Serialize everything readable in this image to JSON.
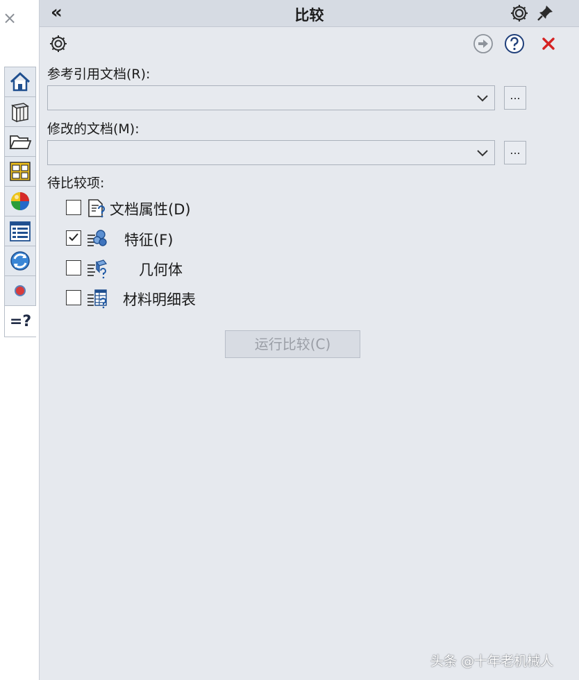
{
  "window": {
    "close_glyph": "×"
  },
  "task_tabs": [
    {
      "name": "home",
      "icon": "home-icon"
    },
    {
      "name": "design-library",
      "icon": "books-icon"
    },
    {
      "name": "file-explorer",
      "icon": "folder-icon"
    },
    {
      "name": "view-palette",
      "icon": "palette-icon"
    },
    {
      "name": "appearances",
      "icon": "appearance-ball-icon"
    },
    {
      "name": "custom-properties",
      "icon": "properties-list-icon"
    },
    {
      "name": "solidworks-resources",
      "icon": "refresh-globe-icon"
    },
    {
      "name": "solidworks-forum",
      "icon": "red-dot-icon"
    },
    {
      "name": "compare",
      "icon": "compare-icon",
      "glyph": "=?"
    }
  ],
  "title_bar": {
    "collapse_glyph": "«",
    "title": "比较"
  },
  "toolbar": {
    "options_icon": "gear-icon",
    "next_icon": "arrow-right-icon",
    "help_icon": "help-icon",
    "cancel_icon": "close-icon"
  },
  "reference_doc": {
    "label": "参考引用文档(R):",
    "value": "",
    "browse_label": "..."
  },
  "modified_doc": {
    "label": "修改的文档(M):",
    "value": "",
    "browse_label": "..."
  },
  "compare_items": {
    "label": "待比较项:",
    "items": [
      {
        "label": "文档属性(D)",
        "checked": false,
        "icon": "document-properties-icon"
      },
      {
        "label": "特征(F)",
        "checked": true,
        "icon": "features-icon"
      },
      {
        "label": "几何体",
        "checked": false,
        "icon": "geometry-icon"
      },
      {
        "label": "材料明细表",
        "checked": false,
        "icon": "bom-icon"
      }
    ]
  },
  "run_button": {
    "label": "运行比较(C)",
    "enabled": false
  },
  "watermark": "头条 @十年老机械人",
  "colors": {
    "pane_bg": "#e6e9ee",
    "titlebar_bg": "#d6dbe3",
    "cancel_red": "#d52222",
    "icon_blue": "#1f5aa6"
  }
}
